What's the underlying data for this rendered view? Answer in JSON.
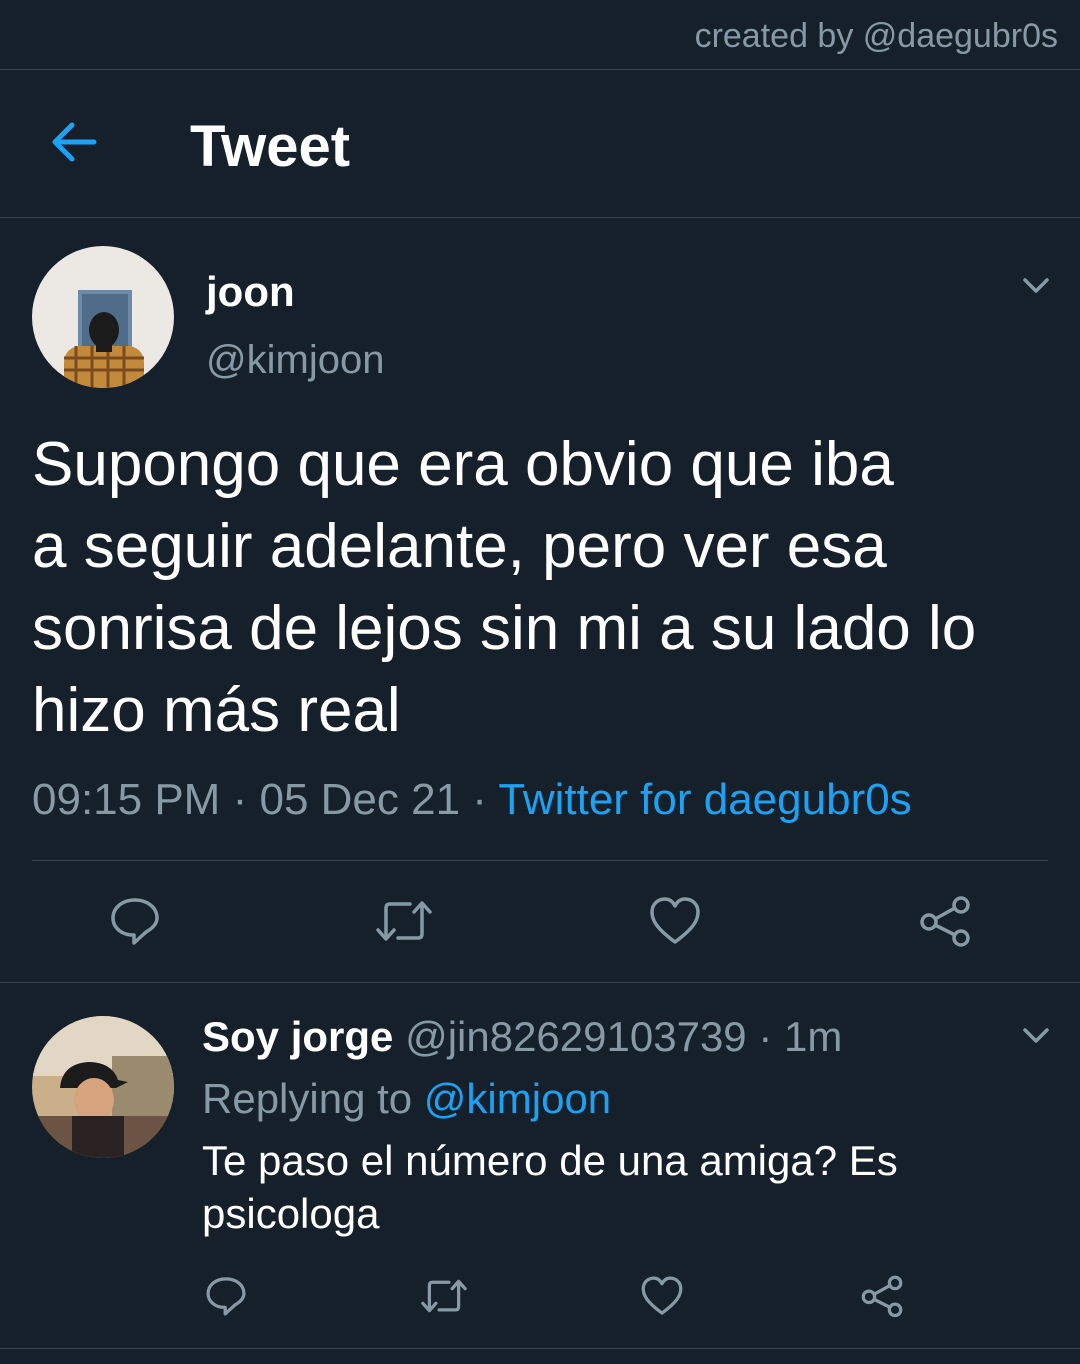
{
  "watermark": "created by @daegubr0s",
  "header": {
    "title": "Tweet",
    "back_icon": "arrow-left-icon"
  },
  "tweet": {
    "author_name": "joon",
    "author_handle": "@kimjoon",
    "text_lines": [
      "Supongo que era obvio que iba",
      "a seguir adelante, pero ver esa",
      "sonrisa de lejos sin mi a su lado lo",
      "hizo más real"
    ],
    "time": "09:15 PM",
    "separator": "·",
    "date": "05 Dec 21",
    "source": "Twitter for daegubr0s",
    "actions": [
      "reply-icon",
      "retweet-icon",
      "like-icon",
      "share-icon"
    ]
  },
  "reply": {
    "author_name": "Soy jorge",
    "author_handle": "@jin82629103739",
    "age": "1m",
    "replying_label": "Replying to",
    "replying_to": "@kimjoon",
    "text": "Te paso el número de una amiga? Es psicologa"
  },
  "colors": {
    "background": "#15202b",
    "divider": "#38444d",
    "secondary_text": "#8899a6",
    "accent": "#1da1f2",
    "primary_text": "#ffffff"
  }
}
